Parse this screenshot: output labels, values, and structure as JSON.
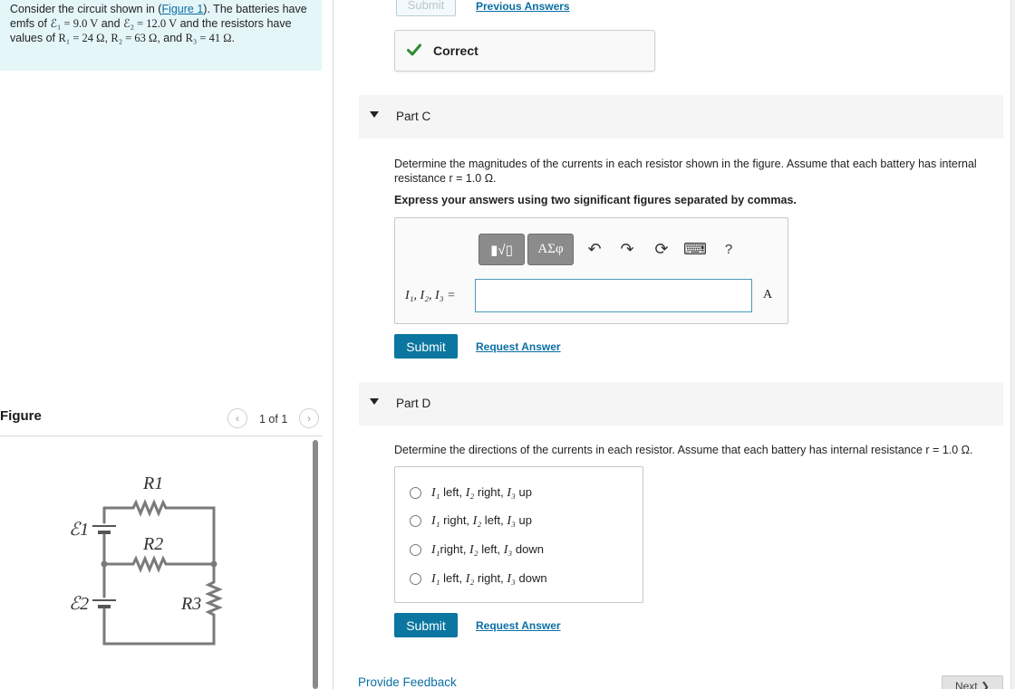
{
  "problem": {
    "text1": "Consider the circuit shown in (",
    "figure_link": "Figure 1",
    "text2": "). The batteries have emfs of ",
    "emf1": "ℰ₁ = 9.0 V",
    "and1": " and ",
    "emf2": "ℰ₂ = 12.0 V",
    "text3": " and the resistors have values of ",
    "r1": "R₁ = 24 Ω",
    "sep1": ", ",
    "r2": "R₂ = 63 Ω",
    "and2": ", and ",
    "r3": "R₃ = 41 Ω",
    "end": "."
  },
  "figure": {
    "title": "Figure",
    "pager": "1 of 1",
    "prev": "‹",
    "next": "›",
    "labels": {
      "r1": "R1",
      "r2": "R2",
      "r3": "R3",
      "e1": "ℰ1",
      "e2": "ℰ2"
    }
  },
  "part_b": {
    "submit_label": "Submit",
    "previous_answers": "Previous Answers",
    "status": "Correct",
    "status_icon": "check-icon",
    "status_color": "#2e8b2e"
  },
  "part_c": {
    "title": "Part C",
    "question": "Determine the magnitudes of the currents in each resistor shown in the figure. Assume that each battery has internal resistance r = 1.0 Ω.",
    "instruction": "Express your answers using two significant figures separated by commas.",
    "toolbar": {
      "templates": "▮√▯",
      "greek": "ΑΣφ",
      "undo": "↶",
      "redo": "↷",
      "reset": "⟳",
      "keyboard": "⌨",
      "help": "?"
    },
    "answer_label": "I₁, I₂, I₃ =",
    "answer_value": "",
    "unit": "A",
    "submit_label": "Submit",
    "request_answer": "Request Answer"
  },
  "part_d": {
    "title": "Part D",
    "question": "Determine the directions of the currents in each resistor. Assume that each battery has internal resistance r = 1.0 Ω.",
    "options": [
      {
        "a": "I₁",
        "a_dir": " left, ",
        "b": "I₂",
        "b_dir": " right, ",
        "c": "I₃",
        "c_dir": " up"
      },
      {
        "a": "I₁",
        "a_dir": " right, ",
        "b": "I₂",
        "b_dir": " left, ",
        "c": "I₃",
        "c_dir": " up"
      },
      {
        "a": "I₁",
        "a_dir": "right, ",
        "b": "I₂",
        "b_dir": " left, ",
        "c": "I₃",
        "c_dir": " down"
      },
      {
        "a": "I₁",
        "a_dir": " left, ",
        "b": "I₂",
        "b_dir": " right, ",
        "c": "I₃",
        "c_dir": " down"
      }
    ],
    "submit_label": "Submit",
    "request_answer": "Request Answer"
  },
  "footer": {
    "feedback": "Provide Feedback",
    "next": "Next ❯"
  },
  "colors": {
    "accent": "#0b76a0",
    "link": "#0b6fa4",
    "problem_bg": "#e5f6f9"
  }
}
